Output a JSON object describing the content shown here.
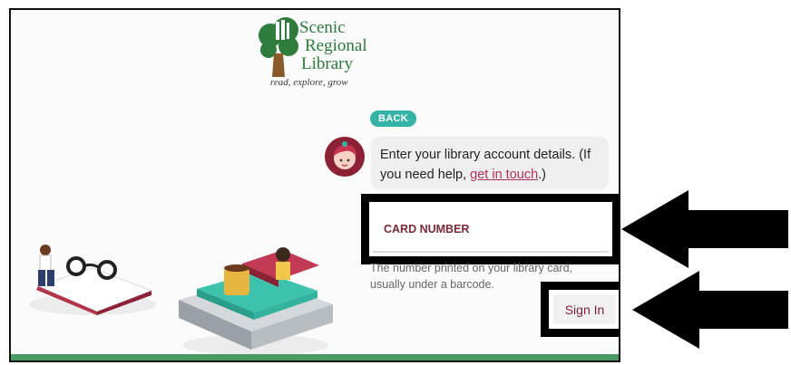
{
  "logo": {
    "name_lines": [
      "Scenic",
      "Regional",
      "Library"
    ],
    "tagline": "read, explore, grow"
  },
  "back_button": "BACK",
  "message": {
    "text_before": "Enter your library account details. (If you need help, ",
    "link": "get in touch",
    "text_after": ".)"
  },
  "card_number": {
    "placeholder": "CARD NUMBER",
    "value": ""
  },
  "help_text": "The number printed on your library card, usually under a barcode.",
  "sign_in_button": "Sign In",
  "colors": {
    "brand_green": "#2c7a3b",
    "teal": "#35b3a6",
    "maroon": "#7a1f3d",
    "link": "#b0305a"
  },
  "icons": [
    "library-tree-logo-icon",
    "reader-avatar-icon",
    "arrow-left-icon"
  ]
}
